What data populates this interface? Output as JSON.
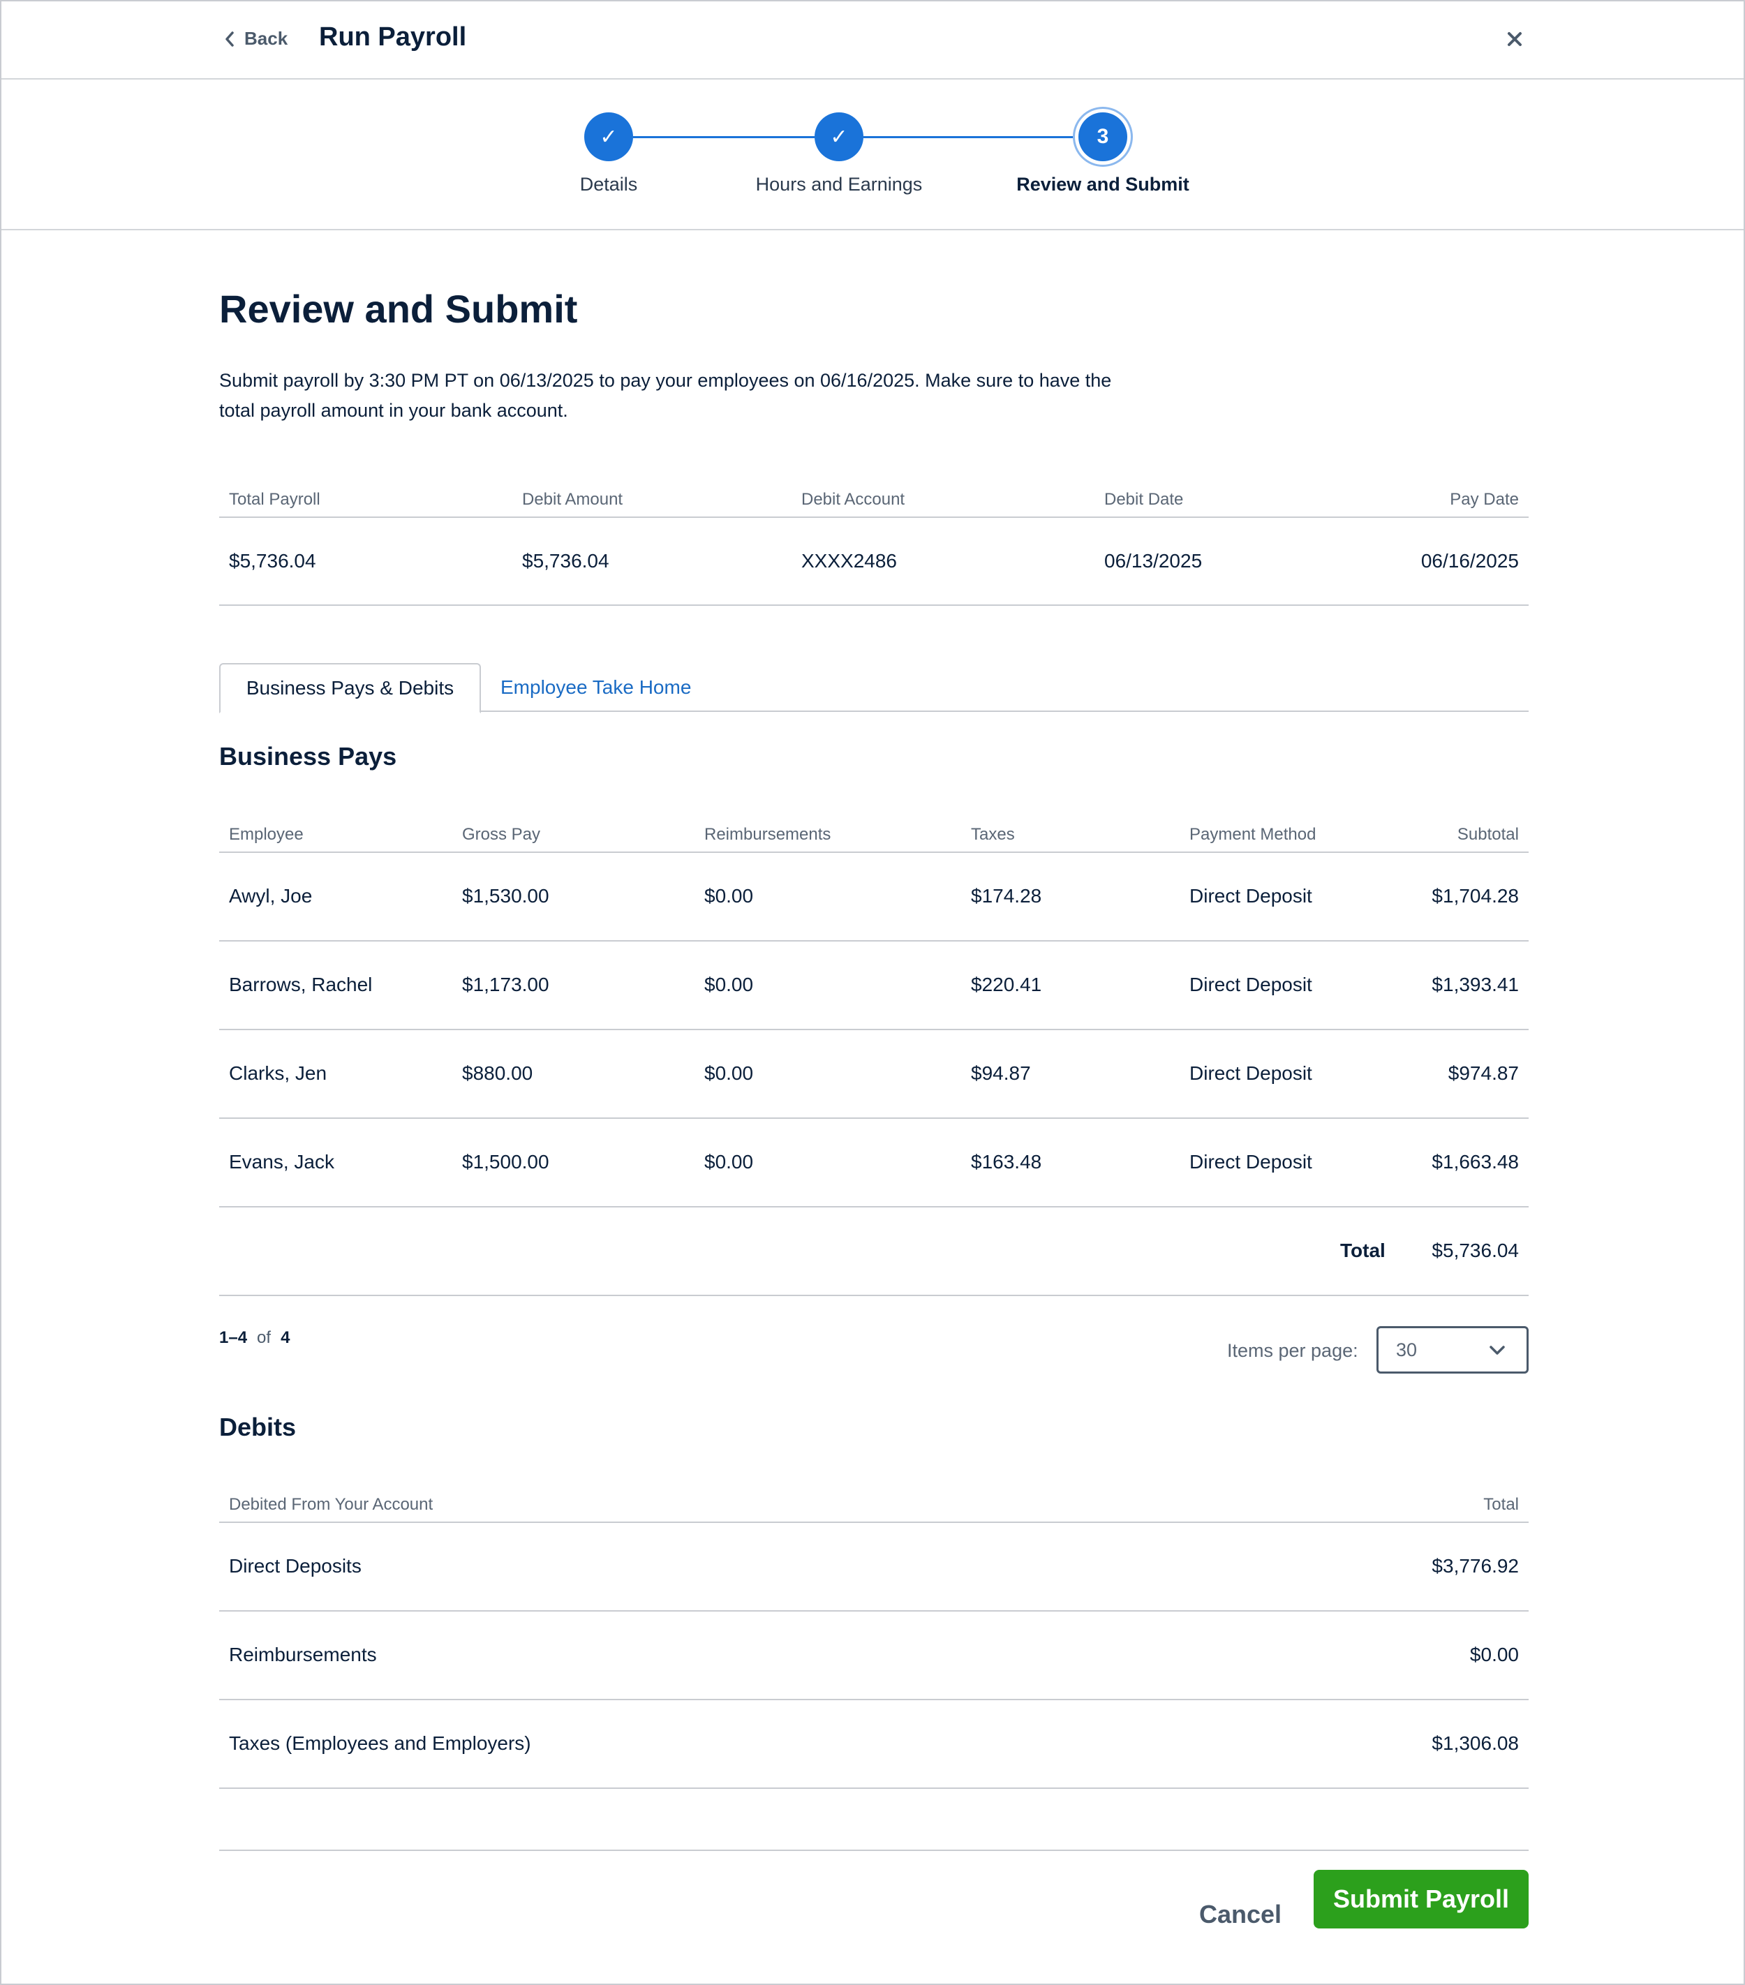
{
  "header": {
    "back_label": "Back",
    "title": "Run Payroll"
  },
  "stepper": {
    "steps": [
      {
        "label": "Details",
        "state": "complete",
        "marker": "✓"
      },
      {
        "label": "Hours and Earnings",
        "state": "complete",
        "marker": "✓"
      },
      {
        "label": "Review and Submit",
        "state": "current",
        "marker": "3"
      }
    ]
  },
  "page": {
    "heading": "Review and Submit",
    "intro": "Submit payroll by 3:30 PM PT on 06/13/2025 to pay your employees on 06/16/2025. Make sure to have the total payroll amount in your bank account."
  },
  "summary": {
    "headers": [
      "Total Payroll",
      "Debit Amount",
      "Debit Account",
      "Debit Date",
      "Pay Date"
    ],
    "values": [
      "$5,736.04",
      "$5,736.04",
      "XXXX2486",
      "06/13/2025",
      "06/16/2025"
    ]
  },
  "tabs": [
    {
      "label": "Business Pays & Debits",
      "active": true
    },
    {
      "label": "Employee Take Home",
      "active": false
    }
  ],
  "business_pays": {
    "title": "Business Pays",
    "headers": [
      "Employee",
      "Gross Pay",
      "Reimbursements",
      "Taxes",
      "Payment Method",
      "Subtotal"
    ],
    "rows": [
      [
        "Awyl, Joe",
        "$1,530.00",
        "$0.00",
        "$174.28",
        "Direct Deposit",
        "$1,704.28"
      ],
      [
        "Barrows, Rachel",
        "$1,173.00",
        "$0.00",
        "$220.41",
        "Direct Deposit",
        "$1,393.41"
      ],
      [
        "Clarks, Jen",
        "$880.00",
        "$0.00",
        "$94.87",
        "Direct Deposit",
        "$974.87"
      ],
      [
        "Evans, Jack",
        "$1,500.00",
        "$0.00",
        "$163.48",
        "Direct Deposit",
        "$1,663.48"
      ]
    ],
    "total_label": "Total",
    "total_value": "$5,736.04"
  },
  "pagination": {
    "range": "1–4",
    "of": "of",
    "count": "4",
    "items_per_page_label": "Items per page:",
    "items_per_page_value": "30"
  },
  "debits": {
    "title": "Debits",
    "headers": [
      "Debited From Your Account",
      "Total"
    ],
    "rows": [
      [
        "Direct Deposits",
        "$3,776.92"
      ],
      [
        "Reimbursements",
        "$0.00"
      ],
      [
        "Taxes (Employees and Employers)",
        "$1,306.08"
      ]
    ]
  },
  "footer": {
    "cancel_label": "Cancel",
    "submit_label": "Submit Payroll"
  },
  "colors": {
    "primary": "#1a73d9",
    "submit": "#2ca01c",
    "link": "#1a6bc4",
    "text": "#0b1f3a"
  }
}
